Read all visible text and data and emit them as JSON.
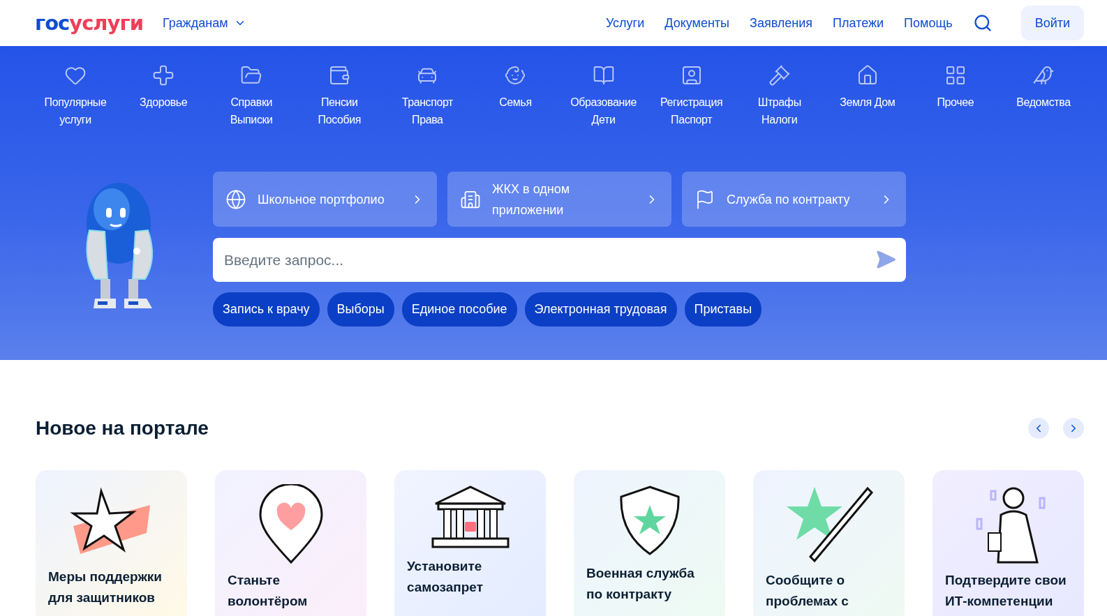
{
  "header": {
    "logo": {
      "part_1": "гос",
      "part_2": "услуги"
    },
    "audience": "Гражданам",
    "nav": [
      "Услуги",
      "Документы",
      "Заявления",
      "Платежи",
      "Помощь"
    ],
    "login": "Войти"
  },
  "categories": [
    {
      "lines": [
        "Популярные",
        "услуги"
      ]
    },
    {
      "lines": [
        "Здоровье"
      ]
    },
    {
      "lines": [
        "Справки",
        "Выписки"
      ]
    },
    {
      "lines": [
        "Пенсии",
        "Пособия"
      ]
    },
    {
      "lines": [
        "Транспорт",
        "Права"
      ]
    },
    {
      "lines": [
        "Семья"
      ]
    },
    {
      "lines": [
        "Образование",
        "Дети"
      ]
    },
    {
      "lines": [
        "Регистрация",
        "Паспорт"
      ]
    },
    {
      "lines": [
        "Штрафы",
        "Налоги"
      ]
    },
    {
      "lines": [
        "Земля Дом"
      ]
    },
    {
      "lines": [
        "Прочее"
      ]
    },
    {
      "lines": [
        "Ведомства"
      ]
    }
  ],
  "promos": [
    "Школьное портфолио",
    "ЖКХ в одном приложении",
    "Служба по контракту"
  ],
  "search": {
    "placeholder": "Введите запрос..."
  },
  "quick_links": [
    "Запись к врачу",
    "Выборы",
    "Единое пособие",
    "Электронная трудовая",
    "Приставы"
  ],
  "news": {
    "title": "Новое на портале",
    "cards": [
      {
        "title": "Меры поддержки для защитников"
      },
      {
        "title": "Станьте волонтёром"
      },
      {
        "title": "Установите самозапрет"
      },
      {
        "title": "Военная служба по контракту"
      },
      {
        "title": "Сообщите о проблемах с"
      },
      {
        "title": "Подтвердите свои ИТ-компетенции"
      }
    ]
  }
}
